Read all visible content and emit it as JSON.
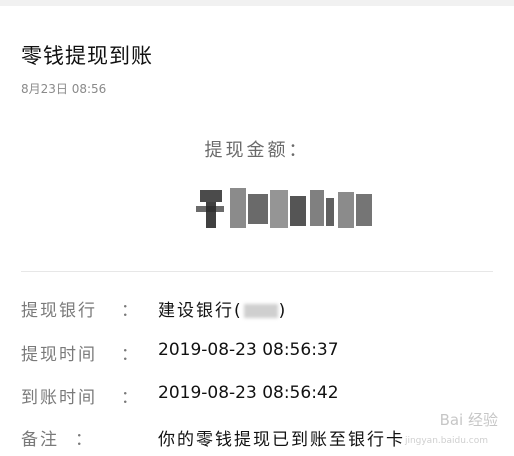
{
  "header": {
    "title": "零钱提现到账",
    "date": "8月23日  08:56"
  },
  "amount": {
    "label": "提现金额：",
    "value_masked": "¥"
  },
  "details": [
    {
      "label": "提现银行",
      "colon": "：",
      "value_prefix": "建设银行(",
      "value_suffix": ")"
    },
    {
      "label": "提现时间",
      "colon": "：",
      "value": "2019-08-23 08:56:37"
    },
    {
      "label": "到账时间",
      "colon": "：",
      "value": "2019-08-23 08:56:42"
    },
    {
      "label": "备注",
      "colon": "：",
      "value": "你的零钱提现已到账至银行卡"
    }
  ],
  "watermark": {
    "text": "Bai 经验",
    "sub": "jingyan.baidu.com"
  },
  "colors": {
    "background": "#ffffff",
    "label_gray": "#7a7a7a",
    "text_dark": "#111111"
  }
}
